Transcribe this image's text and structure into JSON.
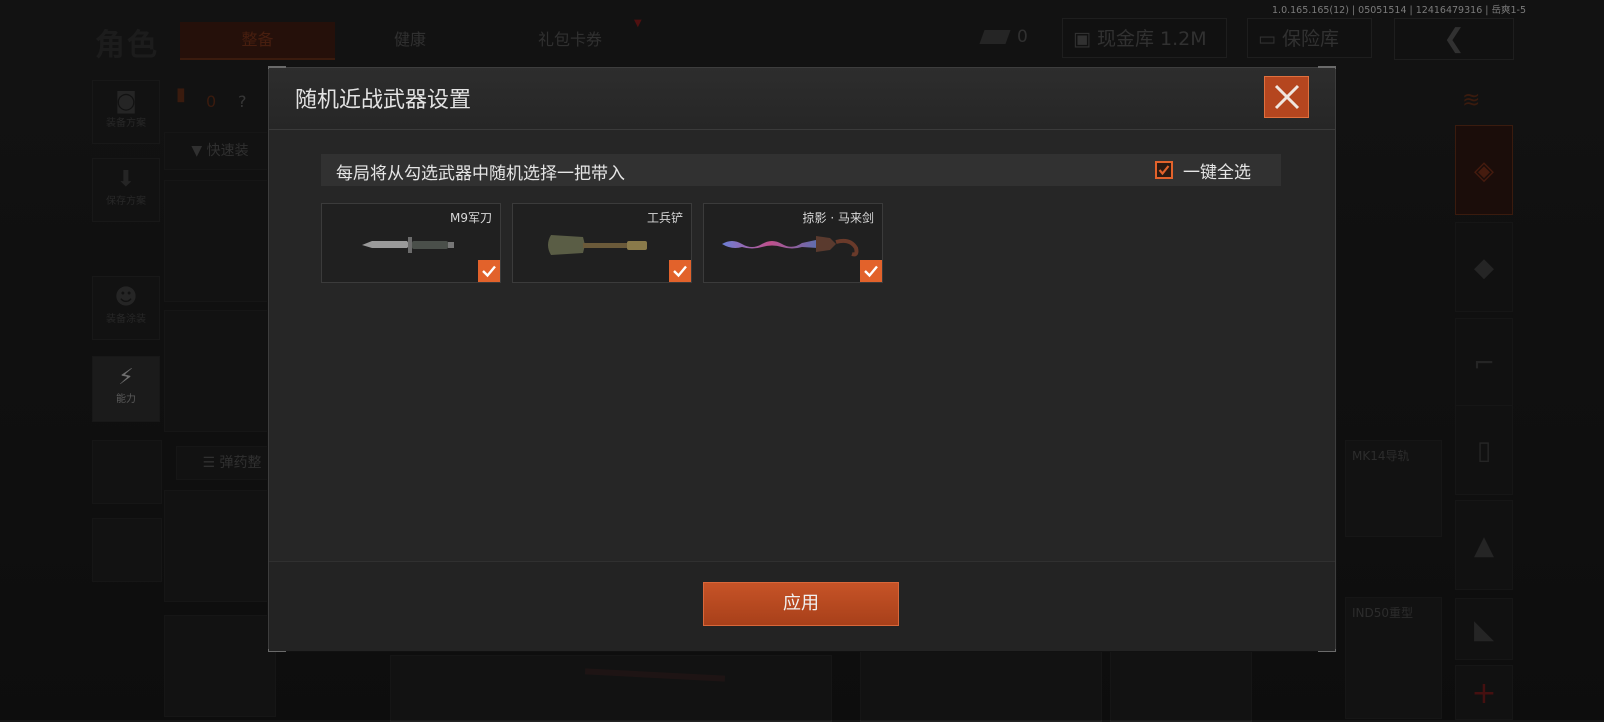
{
  "version": "1.0.165.165(12) | 05051514 | 12416479316 | 岳爽1-5",
  "header": {
    "role_title": "角色",
    "tabs": [
      {
        "label": "整备"
      },
      {
        "label": "健康"
      },
      {
        "label": "礼包卡券"
      }
    ],
    "cash_count": "0",
    "cash_vault_label": "现金库 1.2M",
    "safe_label": "保险库"
  },
  "left_sidebar": {
    "items": [
      {
        "label": "装备方案"
      },
      {
        "label": "保存方案"
      },
      {
        "label": "装备涂装"
      },
      {
        "label": "能力"
      }
    ],
    "bag_count": "0",
    "quick_equip_label": "快速装",
    "ammo_label": "弹药整"
  },
  "right_slots": {
    "mk14_label": "MK14导轨",
    "ind50_label": "IND50重型"
  },
  "dialog": {
    "title": "随机近战武器设置",
    "info_text": "每局将从勾选武器中随机选择一把带入",
    "select_all_label": "一键全选",
    "select_all_checked": true,
    "weapons": [
      {
        "name": "M9军刀",
        "checked": true,
        "icon": "knife-icon"
      },
      {
        "name": "工兵铲",
        "checked": true,
        "icon": "shovel-icon"
      },
      {
        "name": "掠影 · 马来剑",
        "checked": true,
        "icon": "kris-sword-icon"
      }
    ],
    "apply_label": "应用"
  },
  "colors": {
    "accent": "#e2622b",
    "accent_dark": "#b5461f",
    "dialog_bg": "#262626",
    "page_bg": "#161616"
  }
}
